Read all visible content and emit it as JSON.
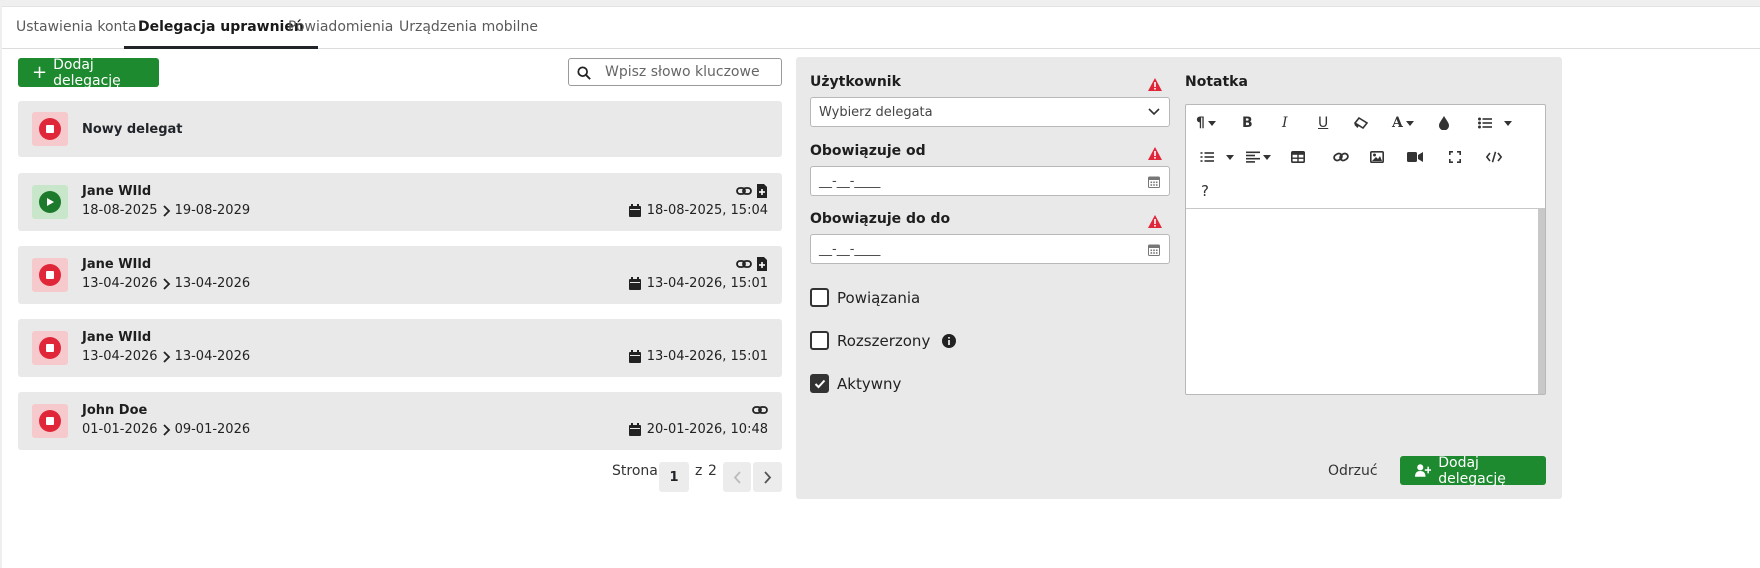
{
  "tabs": [
    {
      "label": "Ustawienia konta"
    },
    {
      "label": "Delegacja uprawnień"
    },
    {
      "label": "Powiadomienia"
    },
    {
      "label": "Urządzenia mobilne"
    }
  ],
  "toolbar": {
    "add_label": "Dodaj delegację",
    "search_placeholder": "Wpisz słowo kluczowe"
  },
  "new_delegate": {
    "label": "Nowy delegat"
  },
  "delegations": [
    {
      "name": "Jane WIld",
      "from": "18-08-2025",
      "to": "19-08-2029",
      "created": "18-08-2025, 15:04",
      "status": "active"
    },
    {
      "name": "Jane WIld",
      "from": "13-04-2026",
      "to": "13-04-2026",
      "created": "13-04-2026, 15:01",
      "status": "stopped"
    },
    {
      "name": "Jane WIld",
      "from": "13-04-2026",
      "to": "13-04-2026",
      "created": "13-04-2026, 15:01",
      "status": "stopped"
    },
    {
      "name": "John Doe",
      "from": "01-01-2026",
      "to": "09-01-2026",
      "created": "20-01-2026, 10:48",
      "status": "stopped"
    }
  ],
  "pager": {
    "label": "Strona",
    "current": "1",
    "of": "z",
    "total": "2"
  },
  "form": {
    "user_label": "Użytkownik",
    "user_placeholder": "Wybierz delegata",
    "from_label": "Obowiązuje od",
    "from_value": "__-__-____",
    "to_label": "Obowiązuje do do",
    "to_value": "__-__-____",
    "links_label": "Powiązania",
    "extended_label": "Rozszerzony",
    "active_label": "Aktywny",
    "note_label": "Notatka",
    "cancel_label": "Odrzuć",
    "save_label": "Dodaj delegację"
  },
  "colors": {
    "primary": "#1e8a2f",
    "danger": "#e0273a",
    "success": "#1d7a2c"
  }
}
